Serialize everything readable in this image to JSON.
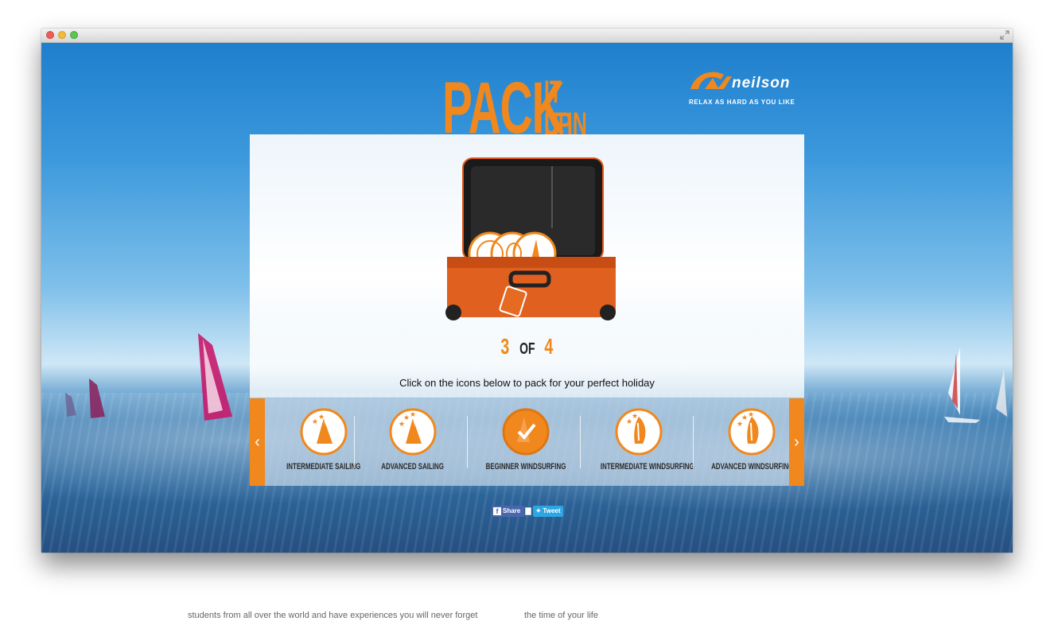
{
  "window": {
    "controls": [
      "close",
      "minimize",
      "zoom"
    ],
    "fullscreen_icon": "fullscreen-icon"
  },
  "header": {
    "campaign_word": "PACK",
    "campaign_line_1": "IT UP",
    "campaign_line_2": "IT IN",
    "brand_name": "neilson",
    "brand_tagline": "RELAX AS HARD AS YOU LIKE"
  },
  "progress": {
    "current": "3",
    "separator": "OF",
    "total": "4"
  },
  "instruction": "Click on the icons below to pack for your perfect holiday",
  "carousel": {
    "prev_icon": "chevron-left-icon",
    "next_icon": "chevron-right-icon",
    "items": [
      {
        "label": "INTERMEDIATE SAILING",
        "icon": "sailing-icon",
        "stars": 2,
        "selected": false
      },
      {
        "label": "ADVANCED SAILING",
        "icon": "sailing-icon",
        "stars": 3,
        "selected": false
      },
      {
        "label": "BEGINNER WINDSURFING",
        "icon": "windsurfing-icon",
        "stars": 1,
        "selected": true
      },
      {
        "label": "INTERMEDIATE WINDSURFING",
        "icon": "windsurfing-icon",
        "stars": 2,
        "selected": false
      },
      {
        "label": "ADVANCED WINDSURFING",
        "icon": "windsurfing-icon",
        "stars": 3,
        "selected": false
      }
    ]
  },
  "social": {
    "share_label": "Share",
    "tweet_label": "Tweet"
  },
  "below_fold": {
    "left_text": "students from all over the world and have experiences you will never forget",
    "right_text": "the time of your life"
  },
  "colors": {
    "accent": "#f0881d",
    "sky": "#2d8fd6",
    "facebook": "#4a67ad",
    "twitter": "#2aa7e4"
  }
}
